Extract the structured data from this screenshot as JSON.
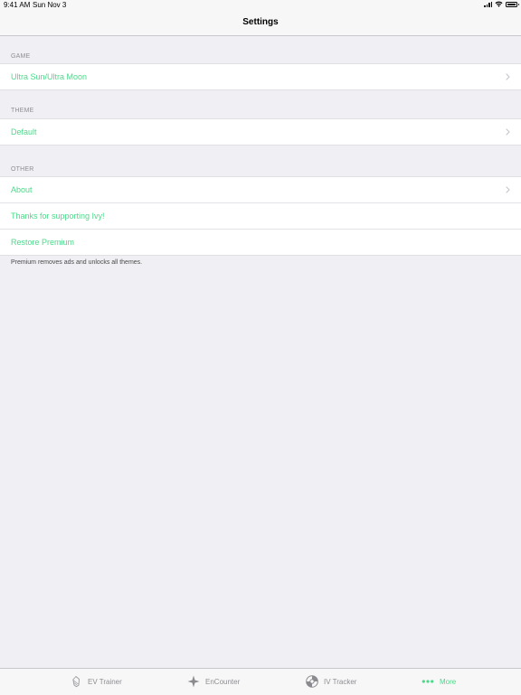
{
  "status": {
    "time": "9:41 AM",
    "date": "Sun Nov 3"
  },
  "nav": {
    "title": "Settings"
  },
  "sections": {
    "game": {
      "header": "GAME",
      "rows": [
        {
          "label": "Ultra Sun/Ultra Moon"
        }
      ]
    },
    "theme": {
      "header": "THEME",
      "rows": [
        {
          "label": "Default"
        }
      ]
    },
    "other": {
      "header": "OTHER",
      "rows": [
        {
          "label": "About"
        },
        {
          "label": "Thanks for supporting Ivy!"
        },
        {
          "label": "Restore Premium"
        }
      ],
      "footer": "Premium removes ads and unlocks all themes."
    }
  },
  "tabs": [
    {
      "label": "EV Trainer",
      "icon": "ev-trainer-icon"
    },
    {
      "label": "EnCounter",
      "icon": "encounter-icon"
    },
    {
      "label": "IV Tracker",
      "icon": "iv-tracker-icon"
    },
    {
      "label": "More",
      "icon": "more-icon"
    }
  ],
  "colors": {
    "accent": "#4cd98a",
    "background": "#efeff4",
    "secondary_text": "#8e8e93"
  }
}
